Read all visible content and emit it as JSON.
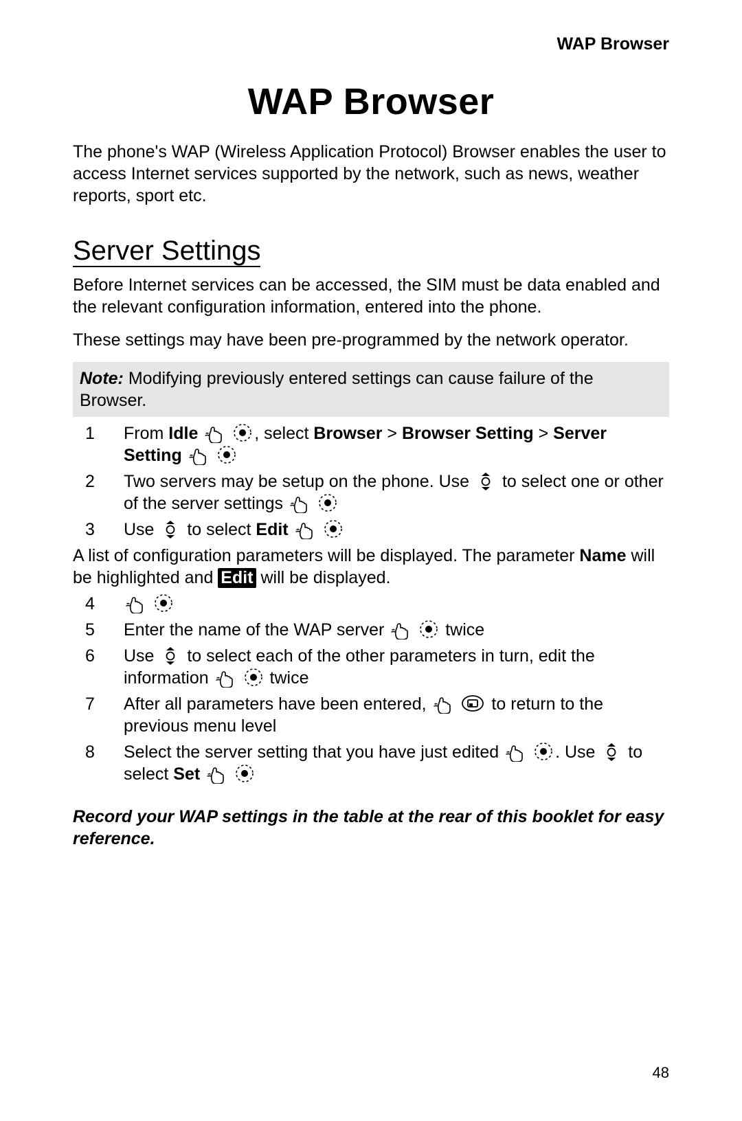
{
  "running_head": "WAP Browser",
  "title": "WAP Browser",
  "intro": "The phone's WAP (Wireless Application Protocol) Browser enables the user to access Internet services supported by the network, such as news, weather reports, sport etc.",
  "section_heading": "Server Settings",
  "section_p1": "Before Internet services can be accessed, the SIM must be data enabled and the relevant configuration information, entered into the phone.",
  "section_p2": "These settings may have been pre-programmed by the network operator.",
  "note_label": "Note:",
  "note_text": " Modifying previously entered settings can cause failure of the Browser.",
  "steps": {
    "s1": {
      "num": "1",
      "a": "From ",
      "idle": "Idle",
      "b": ", select ",
      "browser": "Browser",
      "gt1": " > ",
      "browser_setting": "Browser Setting",
      "gt2": " > ",
      "server_setting": "Server Setting"
    },
    "s2": {
      "num": "2",
      "a": "Two servers may be setup on the phone. Use ",
      "b": " to select one or other of the server settings  "
    },
    "s3": {
      "num": "3",
      "a": "Use ",
      "b": " to select ",
      "edit": "Edit"
    },
    "mid_a": "A list of configuration parameters will be displayed. The parameter ",
    "mid_name": "Name",
    "mid_b": " will be highlighted and ",
    "mid_edit": "Edit",
    "mid_c": " will be displayed.",
    "s4": {
      "num": "4"
    },
    "s5": {
      "num": "5",
      "a": "Enter the name of the WAP server  ",
      "b": " twice"
    },
    "s6": {
      "num": "6",
      "a": "Use ",
      "b": " to select each of the other parameters in turn, edit the information  ",
      "c": " twice"
    },
    "s7": {
      "num": "7",
      "a": "After all parameters have been entered,  ",
      "b": " to return to the previous menu level"
    },
    "s8": {
      "num": "8",
      "a": "Select the server setting that you have just edited  ",
      "b": ". Use ",
      "c": " to select ",
      "set": "Set"
    }
  },
  "footer_note": "Record your WAP settings in the table at the rear of this booklet for easy reference.",
  "page_number": "48"
}
